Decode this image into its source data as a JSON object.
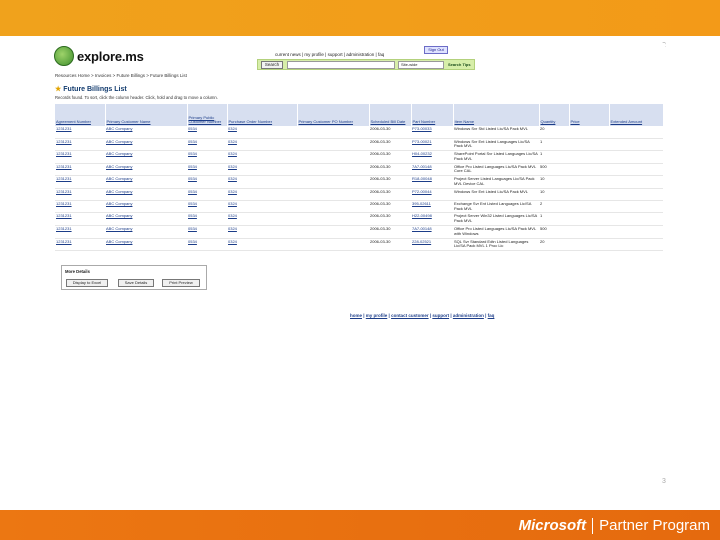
{
  "page": {
    "number_top": "2",
    "number_bottom": "3"
  },
  "brand": {
    "company": "Microsoft",
    "program": "Partner Program"
  },
  "app": {
    "logo_text": "explore.ms",
    "top_links": "current news | my profile | support | administration | faq",
    "signout_label": "Sign Out",
    "search_button": "Search",
    "search_scope": "Site-wide",
    "search_tips": "Search Tips",
    "breadcrumb": "Resources Home > Invoices > Future Billings > Future Billings List",
    "title": "Future Billings List",
    "instructions": "Records found. To sort, click the column header. Click, hold and drag to move a column."
  },
  "table": {
    "columns": [
      "Agreement Number",
      "Primary Customer Name",
      "Primary Public Customer Number",
      "Purchase Order Number",
      "Primary Customer PO Number",
      "Scheduled Bill Date",
      "Part Number",
      "Item Name",
      "Quantity",
      "Price",
      "Extended Amount"
    ],
    "rows": [
      [
        "1231231",
        "ABC Company",
        "0534",
        "0324",
        "",
        "2006-03-30",
        "P73-00033",
        "Windows Svr Std Listed Lic/SA Pack MVL",
        "20",
        "",
        ""
      ],
      [
        "1231231",
        "ABC Company",
        "0534",
        "0324",
        "",
        "2006-03-30",
        "P73-00021",
        "Windows Svr Ent Listed Languages Lic/SA Pack MVL",
        "1",
        "",
        ""
      ],
      [
        "1231231",
        "ABC Company",
        "0534",
        "0324",
        "",
        "2006-03-30",
        "H04-00232",
        "SharePoint Portal Svr Listed Languages Lic/SA Pack MVL",
        "1",
        "",
        ""
      ],
      [
        "1231231",
        "ABC Company",
        "0534",
        "0324",
        "",
        "2006-03-30",
        "7A7-00148",
        "Office Pro Listed Languages Lic/SA Pack MVL Core CAL",
        "500",
        "",
        ""
      ],
      [
        "1231231",
        "ABC Company",
        "0534",
        "0324",
        "",
        "2006-03-30",
        "R18-00048",
        "Project Server Listed Languages Lic/SA Pack MVL Device CAL",
        "10",
        "",
        ""
      ],
      [
        "1231231",
        "ABC Company",
        "0534",
        "0324",
        "",
        "2006-03-30",
        "P72-00044",
        "Windows Svr Ent Listed Lic/SA Pack MVL",
        "10",
        "",
        ""
      ],
      [
        "1231231",
        "ABC Company",
        "0534",
        "0324",
        "",
        "2006-03-30",
        "395-02611",
        "Exchange Svr Ent Listed Languages Lic/SA Pack MVL",
        "2",
        "",
        ""
      ],
      [
        "1231231",
        "ABC Company",
        "0534",
        "0324",
        "",
        "2006-03-30",
        "H22-00498",
        "Project Server Win32 Listed Languages Lic/SA Pack MVL",
        "1",
        "",
        ""
      ],
      [
        "1231231",
        "ABC Company",
        "0534",
        "0324",
        "",
        "2006-03-30",
        "7A7-00148",
        "Office Pro Listed Languages Lic/SA Pack MVL with Windows",
        "500",
        "",
        ""
      ],
      [
        "1231231",
        "ABC Company",
        "0534",
        "0324",
        "",
        "2006-03-30",
        "228-02521",
        "SQL Svr Standard Edtn Listed Languages Lic/SA Pack MVL 1 Proc Lic",
        "20",
        "",
        ""
      ]
    ]
  },
  "more_details": {
    "title": "More Details",
    "buttons": [
      "Display to Excel",
      "Save Details",
      "Print Preview"
    ]
  },
  "footer": {
    "links": [
      "home",
      "my profile",
      "contact customer",
      "support",
      "administration",
      "faq"
    ]
  }
}
